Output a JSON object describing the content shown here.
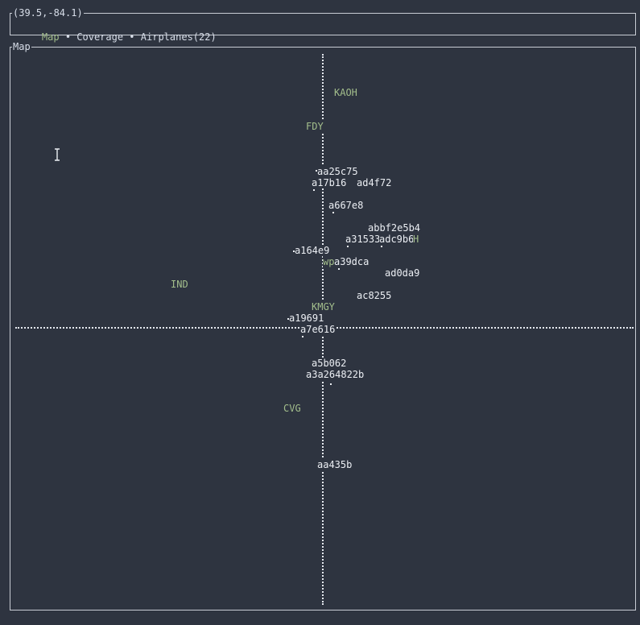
{
  "window": {
    "coord_title": "(39.5,-84.1)",
    "map_title": "Map"
  },
  "nav": {
    "items": [
      "Map",
      "Coverage",
      "Airplanes(22)"
    ],
    "separator": " • ",
    "active": "Map"
  },
  "colors": {
    "background": "#2e3440",
    "airport": "#a3be8c",
    "plane": "#eceff4",
    "border": "#c8ccd4"
  },
  "map": {
    "airports": [
      {
        "code": "KAOH",
        "lat": 40.71,
        "lon": -84.03
      },
      {
        "code": "FDY",
        "lat": 41.01,
        "lon": -83.67
      },
      {
        "code": "IND",
        "lat": 39.72,
        "lon": -86.29
      },
      {
        "code": "KMGY",
        "lat": 39.59,
        "lon": -84.22
      },
      {
        "code": "CVG",
        "lat": 39.05,
        "lon": -84.67
      }
    ],
    "partial_labels": [
      {
        "text": "wp",
        "color": "airport"
      },
      {
        "text": "H",
        "color": "airport"
      }
    ],
    "airplanes": [
      {
        "id": "aa25c75"
      },
      {
        "id": "a17b16"
      },
      {
        "id": "ad4f72"
      },
      {
        "id": "a667e8"
      },
      {
        "id": "abbf2e5b4"
      },
      {
        "id": "a31533"
      },
      {
        "id": "adc9b6"
      },
      {
        "id": "a164e9"
      },
      {
        "id": "a39dca"
      },
      {
        "id": "ad0da9"
      },
      {
        "id": "ac8255"
      },
      {
        "id": "a19691"
      },
      {
        "id": "a7e616"
      },
      {
        "id": "a5b062"
      },
      {
        "id": "a3a264822b"
      },
      {
        "id": "aa435b"
      }
    ]
  }
}
